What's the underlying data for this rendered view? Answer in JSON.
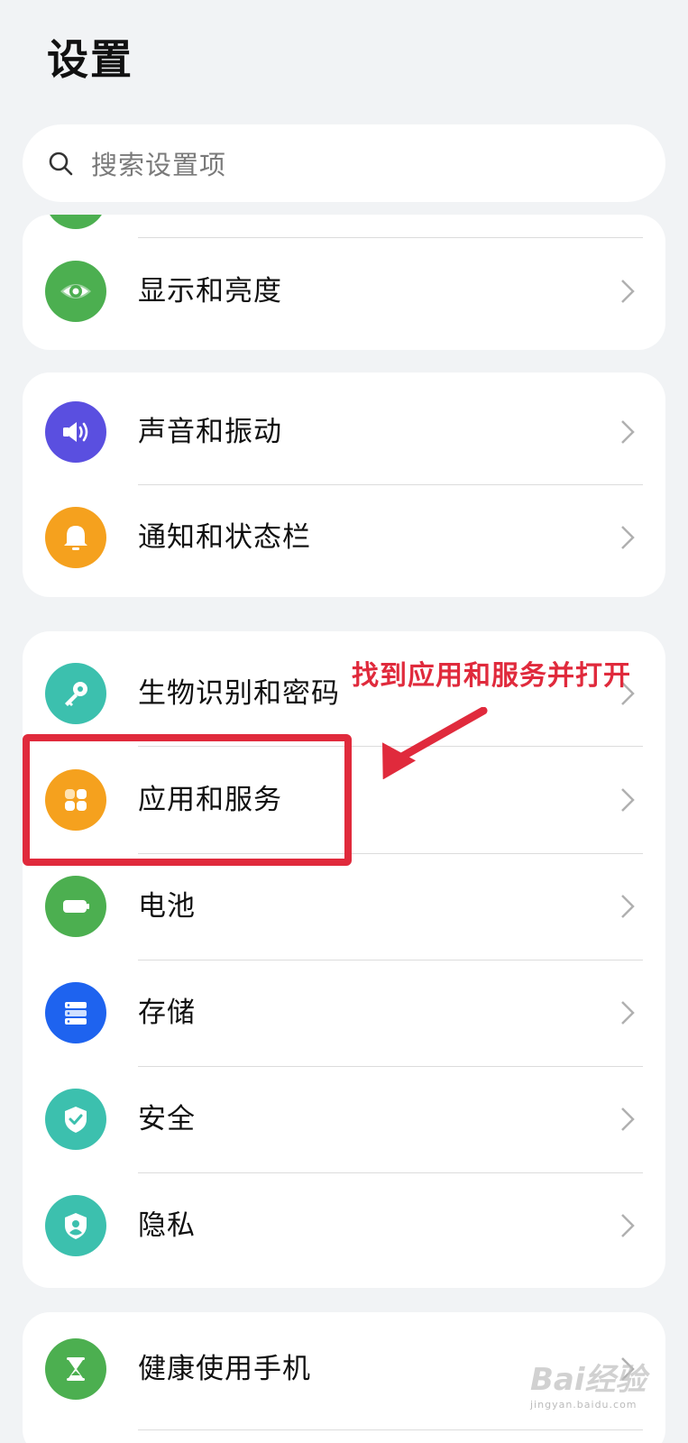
{
  "page": {
    "title": "设置"
  },
  "search": {
    "placeholder": "搜索设置项"
  },
  "groups": [
    {
      "items": [
        {
          "label": "显示和亮度",
          "icon": "eye-icon",
          "color": "#4caf50"
        }
      ]
    },
    {
      "items": [
        {
          "label": "声音和振动",
          "icon": "speaker-icon",
          "color": "#5a4fe0"
        },
        {
          "label": "通知和状态栏",
          "icon": "bell-icon",
          "color": "#f5a11e"
        }
      ]
    },
    {
      "items": [
        {
          "label": "生物识别和密码",
          "icon": "key-icon",
          "color": "#3cc0ae"
        },
        {
          "label": "应用和服务",
          "icon": "apps-grid-icon",
          "color": "#f5a11e"
        },
        {
          "label": "电池",
          "icon": "battery-icon",
          "color": "#4caf50"
        },
        {
          "label": "存储",
          "icon": "storage-icon",
          "color": "#1e63ef"
        },
        {
          "label": "安全",
          "icon": "shield-check-icon",
          "color": "#3cc0ae"
        },
        {
          "label": "隐私",
          "icon": "privacy-shield-icon",
          "color": "#3cc0ae"
        }
      ]
    },
    {
      "items": [
        {
          "label": "健康使用手机",
          "icon": "hourglass-icon",
          "color": "#4caf50"
        }
      ]
    }
  ],
  "annotation": {
    "text": "找到应用和服务并打开",
    "color": "#e02a3c"
  },
  "watermark": {
    "text": "Bai经验",
    "subtext": "jingyan.baidu.com"
  }
}
